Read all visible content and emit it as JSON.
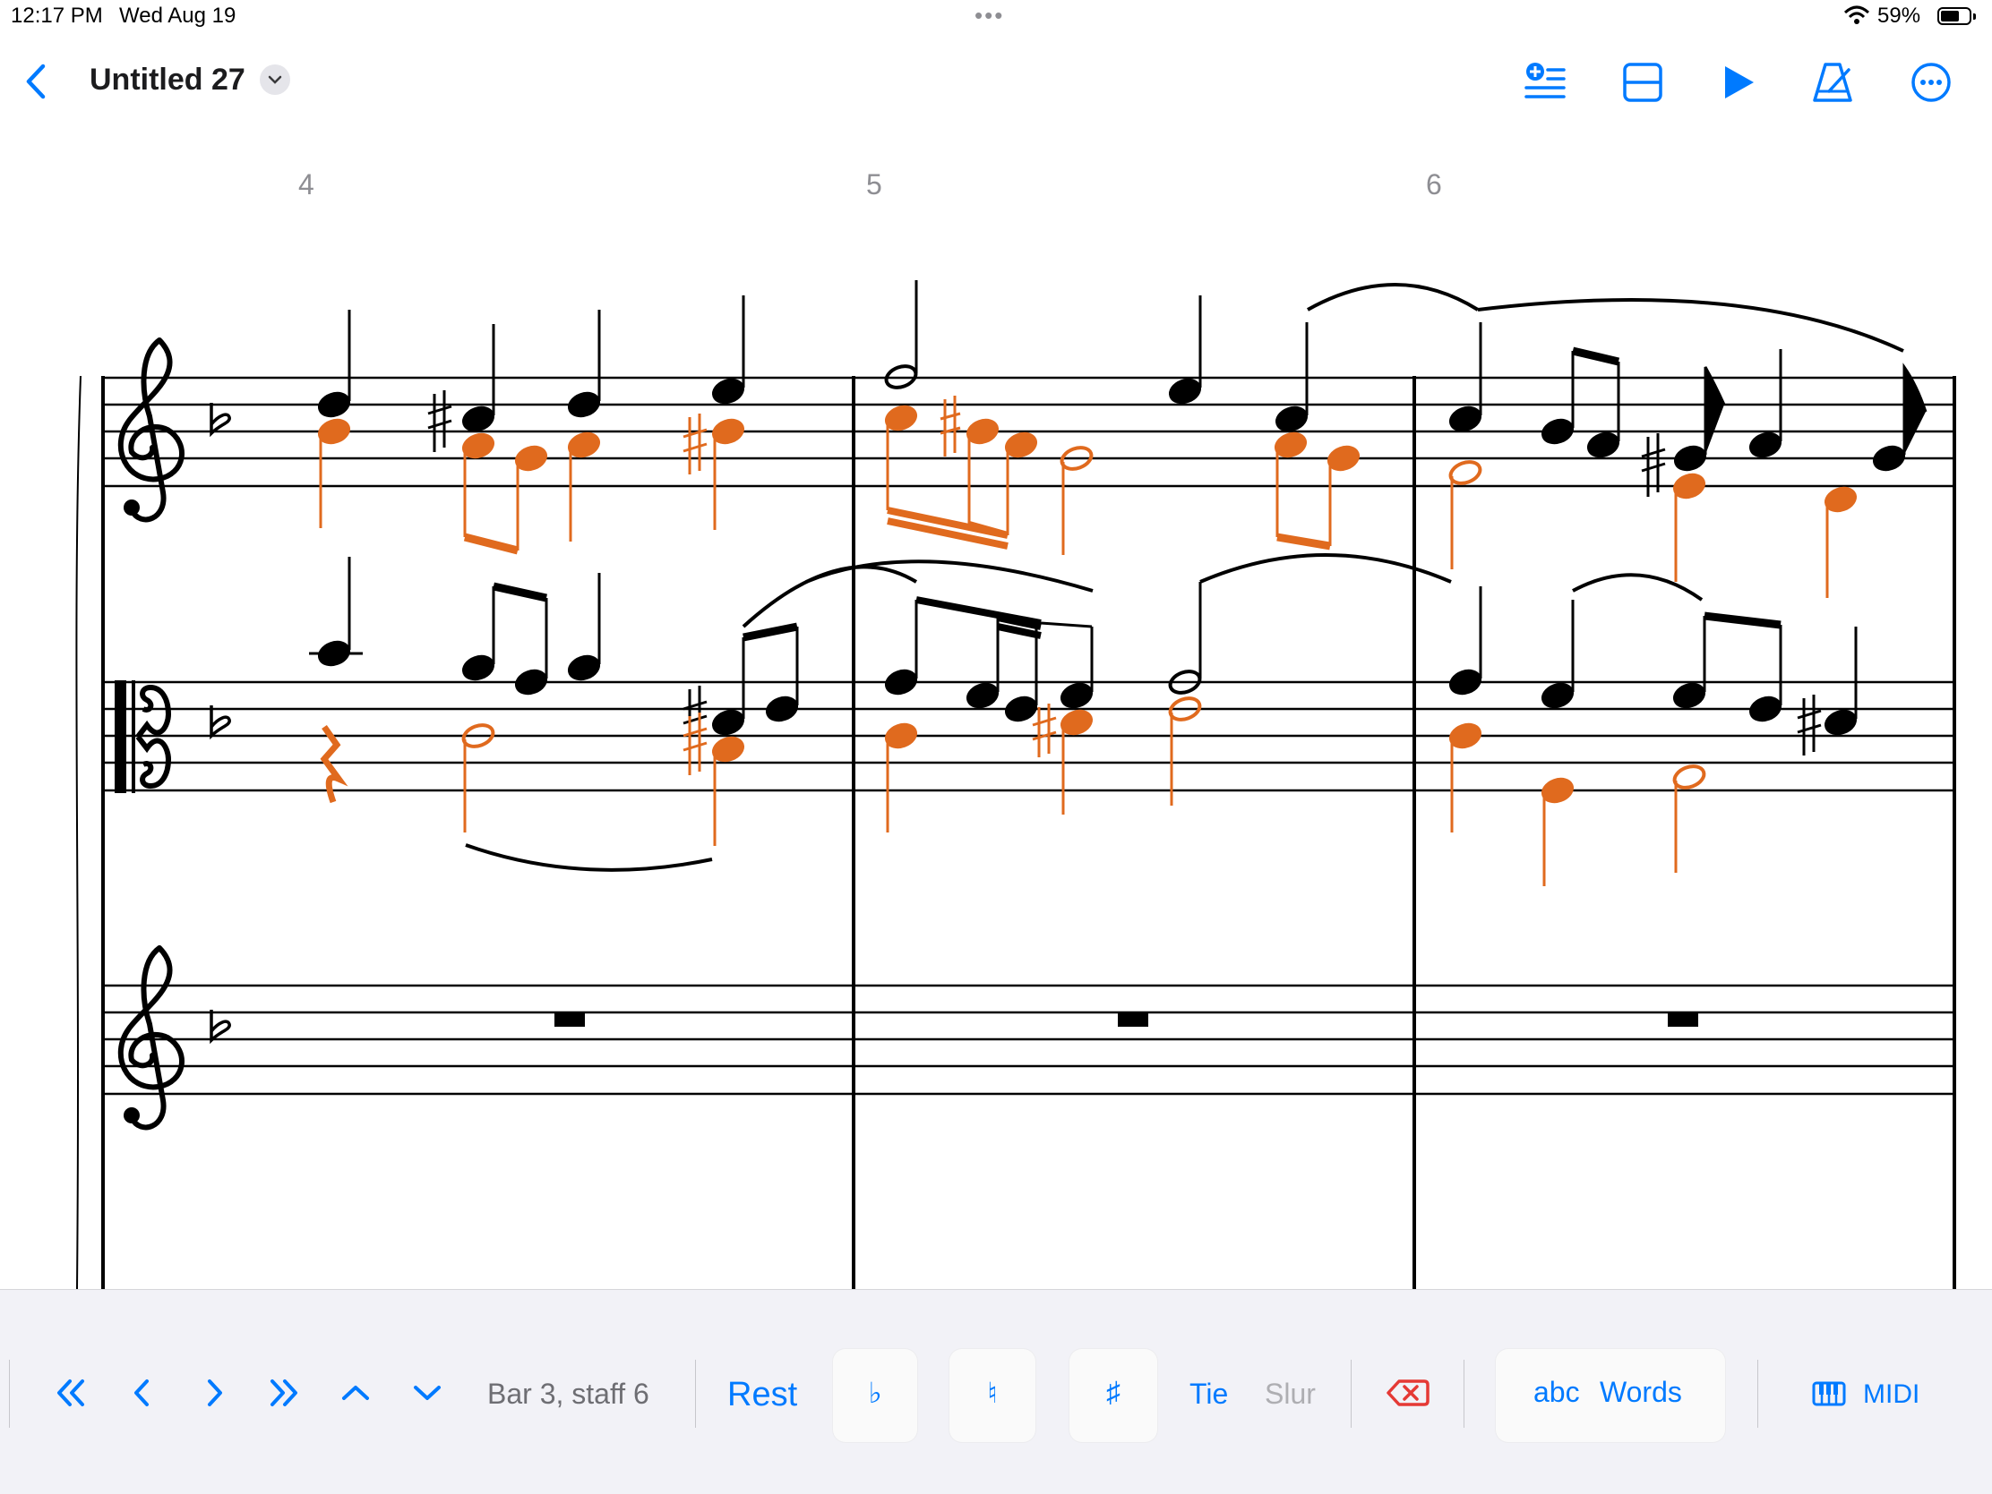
{
  "status_bar": {
    "time": "12:17 PM",
    "date": "Wed Aug 19",
    "battery": "59%"
  },
  "nav": {
    "title": "Untitled 27"
  },
  "score": {
    "bar_numbers": [
      "4",
      "5",
      "6"
    ]
  },
  "toolbar": {
    "position": "Bar 3, staff 6",
    "rest": "Rest",
    "flat": "♭",
    "natural": "♮",
    "sharp": "♯",
    "tie": "Tie",
    "slur": "Slur",
    "abc": "abc",
    "words": "Words",
    "midi": "MIDI"
  },
  "colors": {
    "accent": "#007aff",
    "selection": "#e06a1e",
    "delete": "#e53935"
  }
}
